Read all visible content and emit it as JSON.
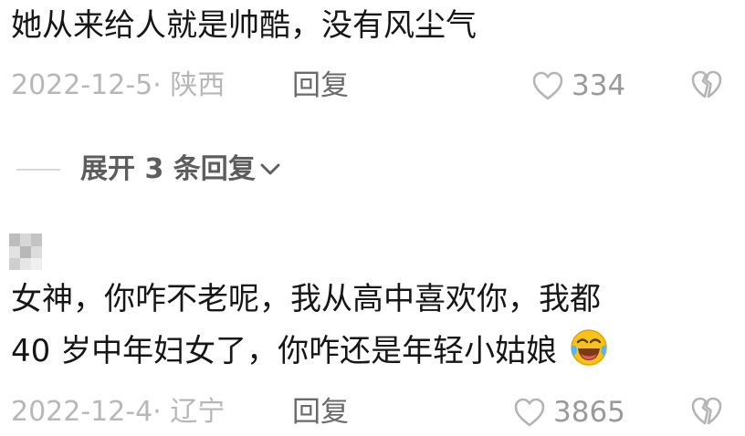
{
  "comments": [
    {
      "text_lines": [
        "她从来给人就是帅酷，没有风尘气"
      ],
      "date_location": "2022-12-5· 陕西",
      "reply_label": "回复",
      "like_count": "334"
    },
    {
      "text_lines": [
        "女神，你咋不老呢，我从高中喜欢你，我都",
        "40 岁中年妇女了，你咋还是年轻小姑娘"
      ],
      "emoji": "laughing-crying-emoji",
      "date_location": "2022-12-4· 辽宁",
      "reply_label": "回复",
      "like_count": "3865"
    }
  ],
  "expand_replies": {
    "label": "展开 3 条回复"
  },
  "icons": {
    "like": "heart-outline-icon",
    "dislike": "broken-heart-icon",
    "expand": "chevron-down-icon"
  },
  "colors": {
    "text_primary": "#161616",
    "text_meta": "#b7b7b7",
    "reply": "#6a6a6a",
    "icon": "#b5b5b5"
  }
}
